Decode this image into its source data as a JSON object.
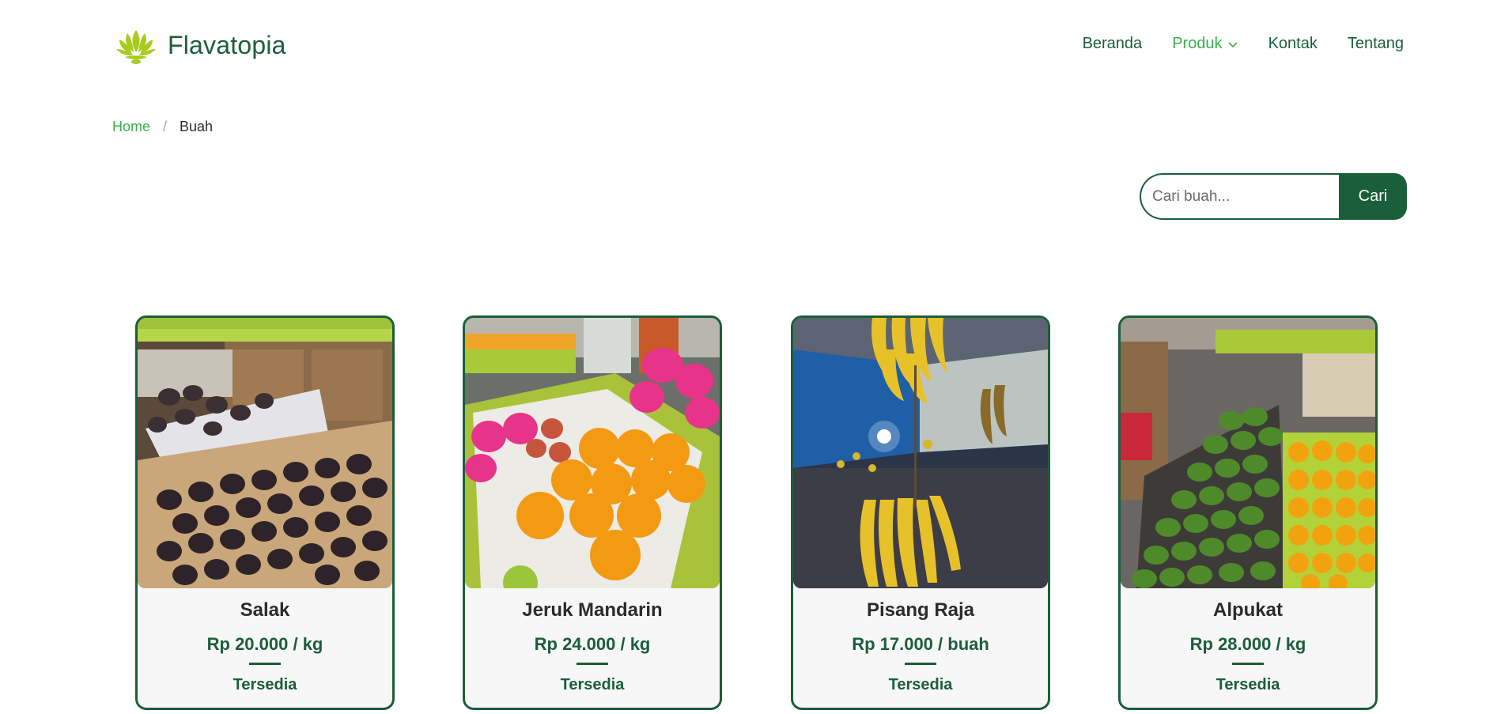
{
  "brand": {
    "name": "Flavatopia",
    "logo_icon": "lotus-icon",
    "logo_color": "#a8cc1e"
  },
  "nav": {
    "items": [
      {
        "label": "Beranda",
        "active": false
      },
      {
        "label": "Produk",
        "active": true,
        "has_dropdown": true
      },
      {
        "label": "Kontak",
        "active": false
      },
      {
        "label": "Tentang",
        "active": false
      }
    ]
  },
  "breadcrumb": {
    "home": "Home",
    "separator": "/",
    "current": "Buah"
  },
  "search": {
    "placeholder": "Cari buah...",
    "value": "",
    "button_label": "Cari"
  },
  "products": [
    {
      "name": "Salak",
      "price": "Rp 20.000 / kg",
      "status": "Tersedia"
    },
    {
      "name": "Jeruk Mandarin",
      "price": "Rp 24.000 / kg",
      "status": "Tersedia"
    },
    {
      "name": "Pisang Raja",
      "price": "Rp 17.000 / buah",
      "status": "Tersedia"
    },
    {
      "name": "Alpukat",
      "price": "Rp 28.000 / kg",
      "status": "Tersedia"
    }
  ],
  "colors": {
    "primary": "#1b5e3a",
    "accent": "#38b24a",
    "card_bg": "#f7f7f7"
  }
}
